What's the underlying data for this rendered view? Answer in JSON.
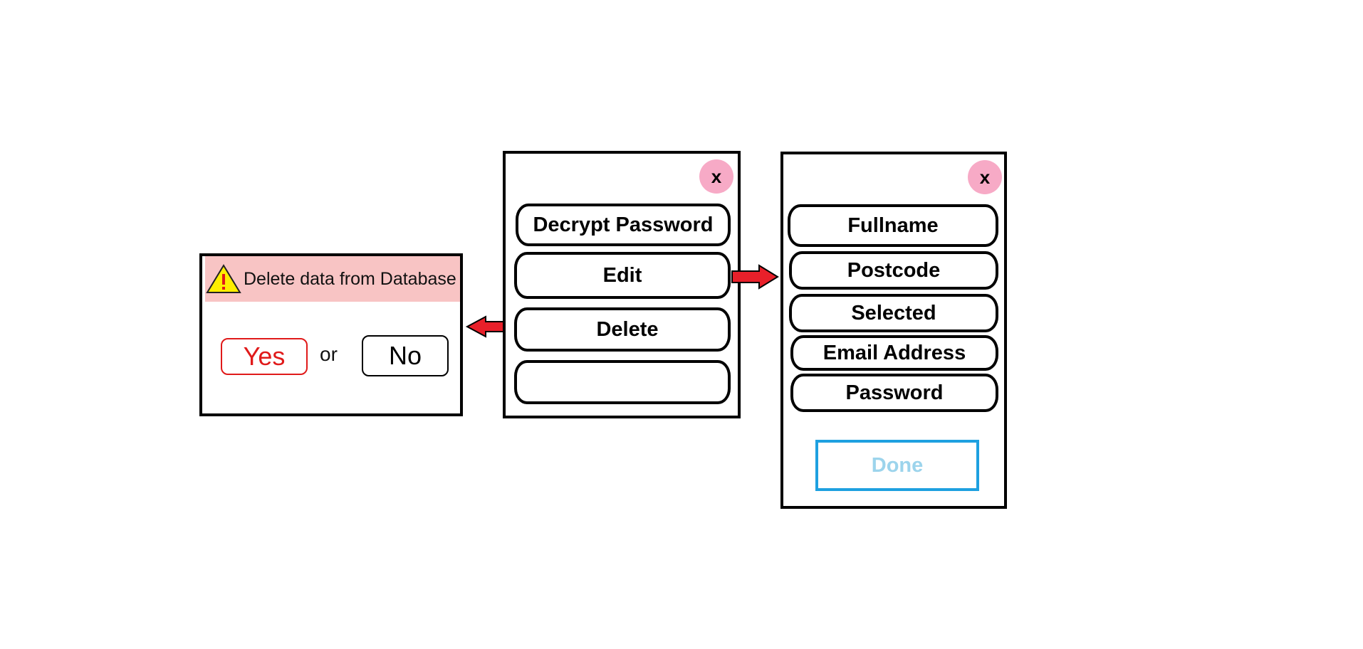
{
  "confirm_dialog": {
    "title": "Delete data from Database",
    "yes_label": "Yes",
    "or_label": "or",
    "no_label": "No",
    "icon": "warning-icon"
  },
  "menu_panel": {
    "close_label": "x",
    "items": [
      {
        "label": "Decrypt Password"
      },
      {
        "label": "Edit"
      },
      {
        "label": "Delete"
      },
      {
        "label": ""
      }
    ]
  },
  "edit_panel": {
    "close_label": "x",
    "fields": [
      {
        "label": "Fullname"
      },
      {
        "label": "Postcode"
      },
      {
        "label": "Selected"
      },
      {
        "label": "Email Address"
      },
      {
        "label": "Password"
      }
    ],
    "done_label": "Done"
  },
  "colors": {
    "warning_header": "#f8c4c4",
    "close_button": "#f7aac6",
    "arrow": "#e8202a",
    "yes": "#e01a1a",
    "done_border": "#1ea0e0",
    "done_text": "#9cd4ec"
  }
}
